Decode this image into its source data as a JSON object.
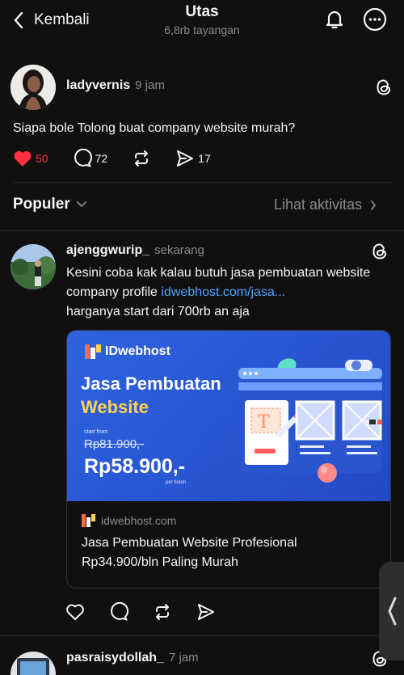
{
  "header": {
    "back_label": "Kembali",
    "title": "Utas",
    "subtitle": "6,8rb tayangan"
  },
  "main_post": {
    "username": "ladyvernis",
    "time": "9 jam",
    "text": "Siapa bole Tolong buat company website murah?",
    "likes": "50",
    "comments": "72",
    "shares": "17"
  },
  "sort_bar": {
    "label": "Populer",
    "activity_label": "Lihat aktivitas"
  },
  "reply": {
    "username": "ajenggwurip_",
    "time": "sekarang",
    "text_prefix": "Kesini coba kak kalau butuh jasa pembuatan website company profile ",
    "link": "idwebhost.com/jasa...",
    "text_suffix": "harganya start dari 700rb an aja",
    "card": {
      "brand": "IDwebhost",
      "headline_1": "Jasa Pembuatan",
      "headline_2": "Website",
      "start_from": "start from",
      "old_price": "Rp81.900,-",
      "new_price": "Rp58.900,-",
      "per": "per bulan",
      "domain": "idwebhost.com",
      "title": "Jasa Pembuatan Website Profesional Rp34.900/bln Paling Murah"
    }
  },
  "next_post": {
    "username": "pasraisydollah_",
    "time": "7 jam"
  },
  "colors": {
    "background": "#101010",
    "like_red": "#ff3040",
    "link_blue": "#4ea3ff",
    "card_blue": "#2a5ad8"
  }
}
